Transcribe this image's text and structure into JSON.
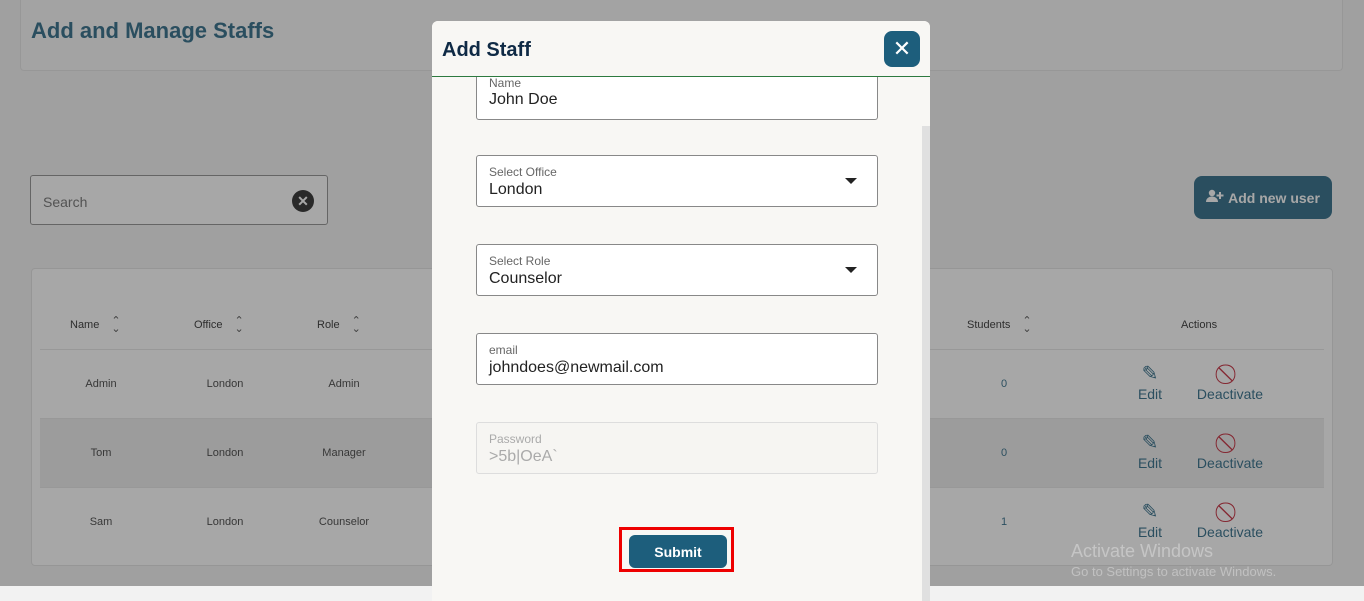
{
  "page": {
    "title": "Add and Manage Staffs",
    "search_placeholder": "Search",
    "add_user_label": "Add new user"
  },
  "table": {
    "columns": [
      "Name",
      "Office",
      "Role",
      "Students",
      "Actions"
    ],
    "rows": [
      {
        "name": "Admin",
        "office": "London",
        "role": "Admin",
        "students": "0",
        "edit": "Edit",
        "deactivate": "Deactivate"
      },
      {
        "name": "Tom",
        "office": "London",
        "role": "Manager",
        "students": "0",
        "edit": "Edit",
        "deactivate": "Deactivate"
      },
      {
        "name": "Sam",
        "office": "London",
        "role": "Counselor",
        "students": "1",
        "edit": "Edit",
        "deactivate": "Deactivate"
      }
    ]
  },
  "modal": {
    "title": "Add Staff",
    "fields": {
      "name": {
        "label": "Name",
        "value": "John Doe"
      },
      "office": {
        "label": "Select Office",
        "value": "London"
      },
      "role": {
        "label": "Select Role",
        "value": "Counselor"
      },
      "email": {
        "label": "email",
        "value": "johndoes@newmail.com"
      },
      "password": {
        "label": "Password",
        "value": ">5b|OeA`"
      }
    },
    "submit_label": "Submit"
  },
  "watermark": {
    "line1": "Activate Windows",
    "line2": "Go to Settings to activate Windows."
  },
  "icons": {
    "close": "close-icon",
    "add_user": "user-plus-icon",
    "edit": "edit-icon",
    "deactivate": "ban-icon"
  },
  "colors": {
    "accent": "#1d5e7c",
    "danger": "#c0182b",
    "highlight": "#ee0000"
  }
}
